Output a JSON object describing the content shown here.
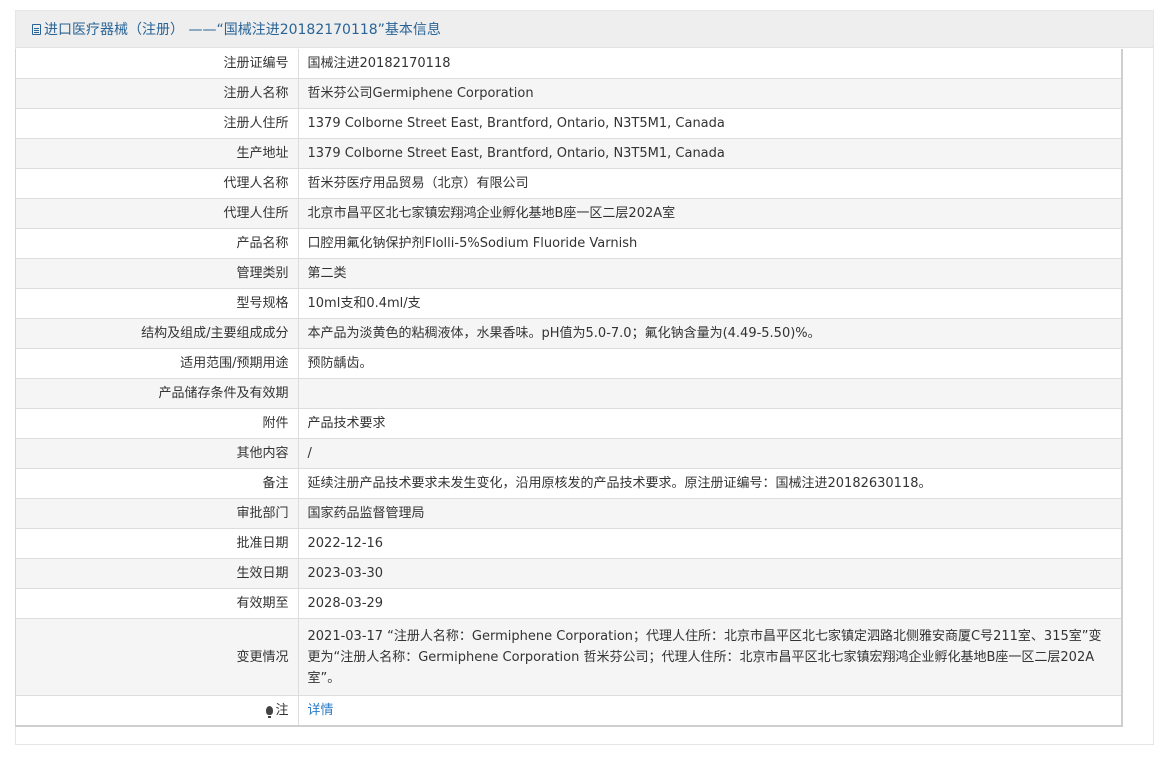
{
  "header": {
    "title": "进口医疗器械（注册） ——“国械注进20182170118”基本信息"
  },
  "rows": [
    {
      "label": "注册证编号",
      "value": "国械注进20182170118"
    },
    {
      "label": "注册人名称",
      "value": "哲米芬公司Germiphene Corporation"
    },
    {
      "label": "注册人住所",
      "value": "1379 Colborne Street East, Brantford, Ontario, N3T5M1, Canada"
    },
    {
      "label": "生产地址",
      "value": "1379 Colborne Street East, Brantford, Ontario, N3T5M1, Canada"
    },
    {
      "label": "代理人名称",
      "value": "哲米芬医疗用品贸易（北京）有限公司"
    },
    {
      "label": "代理人住所",
      "value": "北京市昌平区北七家镇宏翔鸿企业孵化基地B座一区二层202A室"
    },
    {
      "label": "产品名称",
      "value": "口腔用氟化钠保护剂Flolli-5%Sodium Fluoride Varnish"
    },
    {
      "label": "管理类别",
      "value": "第二类"
    },
    {
      "label": "型号规格",
      "value": "10ml支和0.4ml/支"
    },
    {
      "label": "结构及组成/主要组成成分",
      "value": "本产品为淡黄色的粘稠液体，水果香味。pH值为5.0-7.0；氟化钠含量为(4.49-5.50)%。"
    },
    {
      "label": "适用范围/预期用途",
      "value": "预防龋齿。"
    },
    {
      "label": "产品储存条件及有效期",
      "value": ""
    },
    {
      "label": "附件",
      "value": "产品技术要求"
    },
    {
      "label": "其他内容",
      "value": "/"
    },
    {
      "label": "备注",
      "value": "延续注册产品技术要求未发生变化，沿用原核发的产品技术要求。原注册证编号：国械注进20182630118。"
    },
    {
      "label": "审批部门",
      "value": "国家药品监督管理局"
    },
    {
      "label": "批准日期",
      "value": "2022-12-16"
    },
    {
      "label": "生效日期",
      "value": "2023-03-30"
    },
    {
      "label": "有效期至",
      "value": "2028-03-29"
    },
    {
      "label": "变更情况",
      "value": "2021-03-17 “注册人名称：Germiphene Corporation；代理人住所：北京市昌平区北七家镇定泗路北侧雅安商厦C号211室、315室”变更为“注册人名称：Germiphene Corporation 哲米芬公司；代理人住所：北京市昌平区北七家镇宏翔鸿企业孵化基地B座一区二层202A室”。"
    }
  ],
  "note": {
    "label": "注",
    "icon": "bulb-icon",
    "link_text": "详情"
  }
}
